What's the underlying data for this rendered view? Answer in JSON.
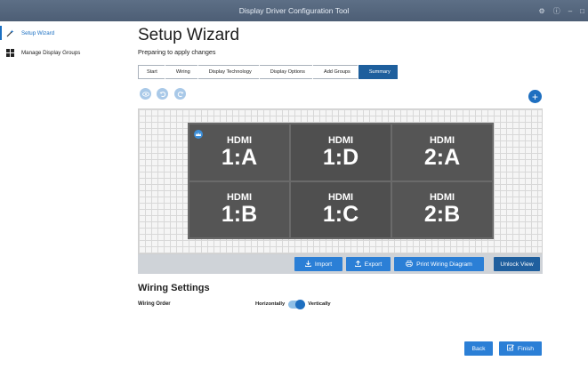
{
  "window": {
    "title": "Display Driver Configuration Tool",
    "controls": [
      "⚙",
      "ⓘ",
      "–",
      "□"
    ]
  },
  "sidebar": {
    "items": [
      {
        "label": "Setup Wizard",
        "active": true
      },
      {
        "label": "Manage Display Groups",
        "active": false
      }
    ]
  },
  "header": {
    "title": "Setup Wizard",
    "subtitle": "Preparing to apply changes"
  },
  "wizard": {
    "steps": [
      "Start",
      "Wiring",
      "Display Technology",
      "Display Options",
      "Add Groups",
      "Summary"
    ],
    "active_step": "Summary"
  },
  "canvas": {
    "tiles": [
      {
        "port": "HDMI",
        "id": "1:A"
      },
      {
        "port": "HDMI",
        "id": "1:D"
      },
      {
        "port": "HDMI",
        "id": "2:A"
      },
      {
        "port": "HDMI",
        "id": "1:B"
      },
      {
        "port": "HDMI",
        "id": "1:C"
      },
      {
        "port": "HDMI",
        "id": "2:B"
      }
    ]
  },
  "actions": {
    "import": "Import",
    "export": "Export",
    "print": "Print Wiring Diagram",
    "unlock": "Unlock View"
  },
  "wiring": {
    "title": "Wiring Settings",
    "order_label": "Wiring Order",
    "option_left": "Horizontally",
    "option_right": "Vertically",
    "value": "Vertically"
  },
  "footer": {
    "back": "Back",
    "finish": "Finish"
  },
  "colors": {
    "accent": "#2b7fd6",
    "active_step": "#1e5f9d",
    "tile": "#555555"
  }
}
